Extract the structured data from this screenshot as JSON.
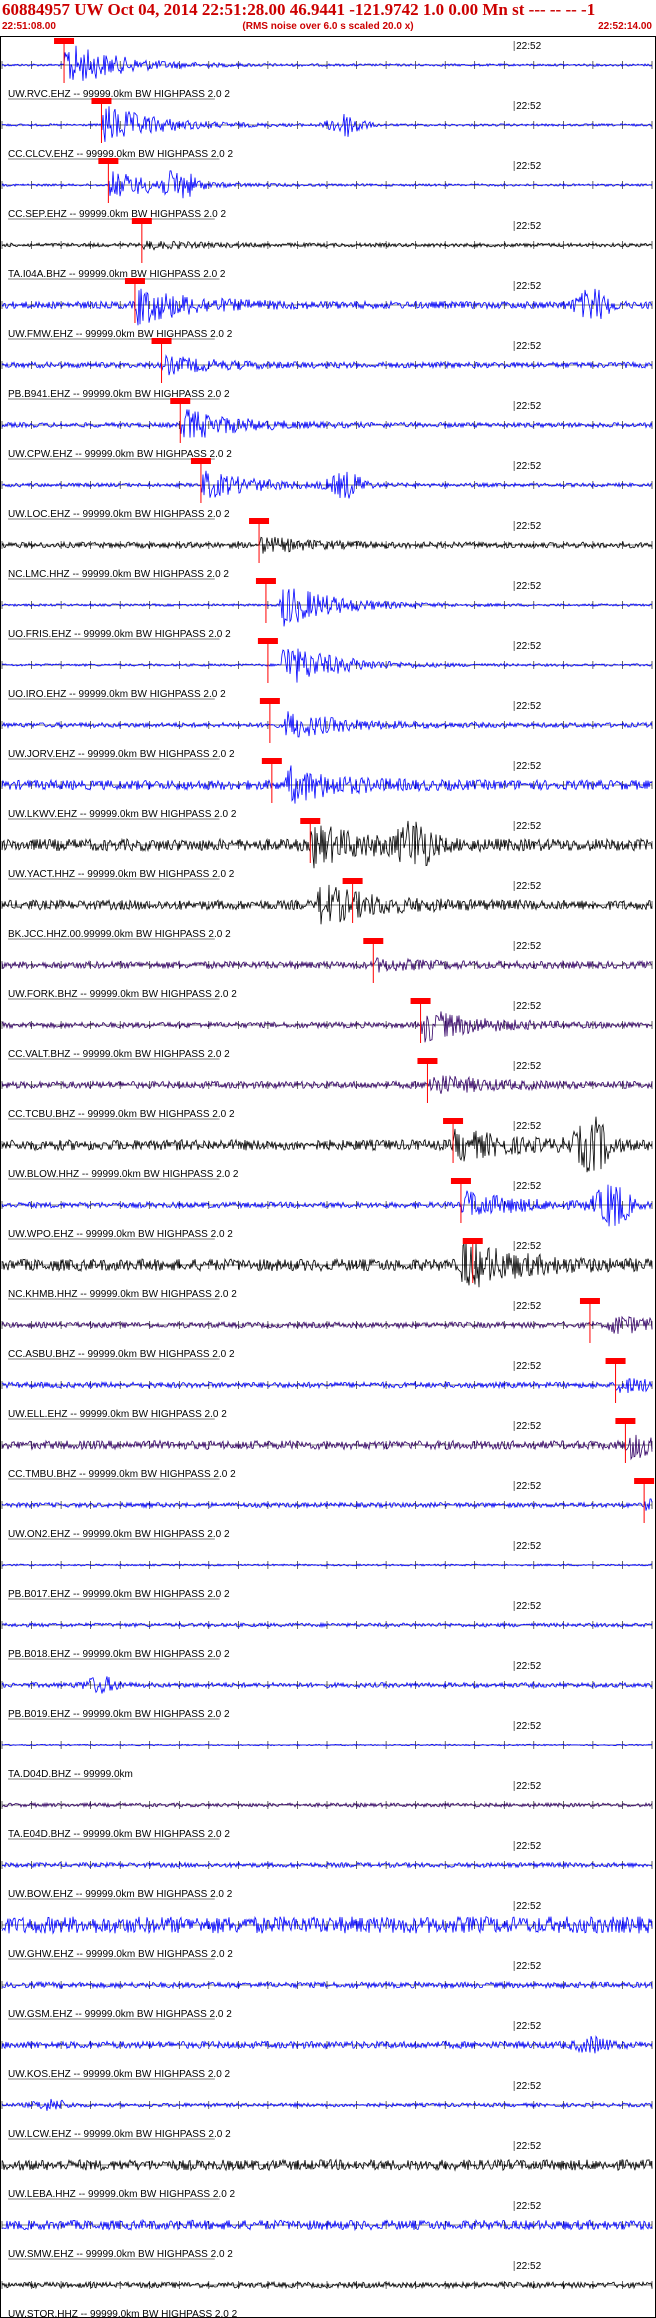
{
  "header": {
    "title": "60884957 UW Oct 04, 2014 22:51:28.00   46.9441 -121.9742  1.0 0.00 Mn st --- -- --  -1",
    "start_time": "22:51:08.00",
    "end_time": "22:52:14.00",
    "rms_note": "(RMS noise over 6.0 s scaled 20.0 x)"
  },
  "chart_data": {
    "type": "line",
    "x_range_seconds": [
      0,
      66
    ],
    "minor_tick_interval_s": 3,
    "time_label": "22:52",
    "time_label_offset_s": 52,
    "colors": {
      "blue": "#0000ff",
      "black": "#000000",
      "purple": "#330066",
      "pick": "#ff0000"
    },
    "series": [
      {
        "label": "UW.RVC.EHZ -- 99999.0km BW  HIGHPASS  2.0  2",
        "color": "blue",
        "pick": 6.3,
        "onset": 6.3,
        "amp": 1.0,
        "noise": 0.05,
        "secondary": null
      },
      {
        "label": "CC.CLCV.EHZ -- 99999.0km BW  HIGHPASS  2.0  2",
        "color": "blue",
        "pick": 10.1,
        "onset": 10.1,
        "amp": 0.9,
        "noise": 0.05,
        "secondary": [
          35,
          0.5
        ]
      },
      {
        "label": "CC.SEP.EHZ -- 99999.0km BW  HIGHPASS  2.0  2",
        "color": "blue",
        "pick": 10.8,
        "onset": 10.8,
        "amp": 0.6,
        "noise": 0.05,
        "secondary": [
          18,
          0.5
        ]
      },
      {
        "label": "TA.I04A.BHZ -- 99999.0km BW  HIGHPASS  2.0  2",
        "color": "black",
        "pick": 14.2,
        "onset": 14.2,
        "amp": 0.15,
        "noise": 0.08,
        "secondary": null
      },
      {
        "label": "UW.FMW.EHZ -- 99999.0km BW  HIGHPASS  2.0  2",
        "color": "blue",
        "pick": 13.5,
        "onset": 13.5,
        "amp": 0.8,
        "noise": 0.15,
        "secondary": [
          60,
          0.6
        ]
      },
      {
        "label": "PB.B941.EHZ -- 99999.0km BW  HIGHPASS  2.0  2",
        "color": "blue",
        "pick": 16.2,
        "onset": 16.2,
        "amp": 0.35,
        "noise": 0.12,
        "secondary": null
      },
      {
        "label": "UW.CPW.EHZ -- 99999.0km BW  HIGHPASS  2.0  2",
        "color": "blue",
        "pick": 18.1,
        "onset": 18.1,
        "amp": 0.7,
        "noise": 0.1,
        "secondary": null
      },
      {
        "label": "UW.LOC.EHZ -- 99999.0km BW  HIGHPASS  2.0  2",
        "color": "blue",
        "pick": 20.2,
        "onset": 20.2,
        "amp": 0.6,
        "noise": 0.08,
        "secondary": [
          35,
          0.5
        ]
      },
      {
        "label": "NC.LMC.HHZ -- 99999.0km BW  HIGHPASS  2.0  2",
        "color": "black",
        "pick": 26.1,
        "onset": 26.1,
        "amp": 0.3,
        "noise": 0.12,
        "secondary": null
      },
      {
        "label": "UO.FRIS.EHZ -- 99999.0km BW  HIGHPASS  2.0  2",
        "color": "blue",
        "pick": 26.8,
        "onset": 28.1,
        "amp": 1.0,
        "noise": 0.05,
        "secondary": null
      },
      {
        "label": "UO.IRO.EHZ -- 99999.0km BW  HIGHPASS  2.0  2",
        "color": "blue",
        "pick": 27.0,
        "onset": 28.3,
        "amp": 1.0,
        "noise": 0.05,
        "secondary": null
      },
      {
        "label": "UW.JORV.EHZ -- 99999.0km BW  HIGHPASS  2.0  2",
        "color": "blue",
        "pick": 27.2,
        "onset": 28.7,
        "amp": 0.6,
        "noise": 0.1,
        "secondary": null
      },
      {
        "label": "UW.LKWV.EHZ -- 99999.0km BW  HIGHPASS  2.0  2",
        "color": "blue",
        "pick": 27.4,
        "onset": 28.8,
        "amp": 0.7,
        "noise": 0.2,
        "secondary": null
      },
      {
        "label": "UW.YACT.HHZ -- 99999.0km BW  HIGHPASS  2.0  2",
        "color": "black",
        "pick": 31.3,
        "onset": 31.3,
        "amp": 0.8,
        "noise": 0.25,
        "secondary": [
          42,
          0.9
        ]
      },
      {
        "label": "BK.JCC.HHZ.00.99999.0km BW  HIGHPASS  2.0  2",
        "color": "black",
        "pick": 35.6,
        "onset": 32.0,
        "amp": 0.85,
        "noise": 0.2,
        "secondary": null
      },
      {
        "label": "UW.FORK.BHZ -- 99999.0km BW  HIGHPASS  2.0  2",
        "color": "purple",
        "pick": 37.7,
        "onset": 37.7,
        "amp": 0.2,
        "noise": 0.15,
        "secondary": null
      },
      {
        "label": "CC.VALT.BHZ -- 99999.0km BW  HIGHPASS  2.0  2",
        "color": "purple",
        "pick": 42.5,
        "onset": 42.5,
        "amp": 0.7,
        "noise": 0.12,
        "secondary": null
      },
      {
        "label": "CC.TCBU.BHZ -- 99999.0km BW  HIGHPASS  2.0  2",
        "color": "purple",
        "pick": 43.2,
        "onset": 43.2,
        "amp": 0.4,
        "noise": 0.15,
        "secondary": null
      },
      {
        "label": "UW.BLOW.HHZ -- 99999.0km BW  HIGHPASS  2.0  2",
        "color": "black",
        "pick": 45.8,
        "onset": 45.8,
        "amp": 0.6,
        "noise": 0.22,
        "secondary": [
          60,
          1.0
        ]
      },
      {
        "label": "UW.WPO.EHZ -- 99999.0km BW  HIGHPASS  2.0  2",
        "color": "blue",
        "pick": 46.6,
        "onset": 46.6,
        "amp": 0.6,
        "noise": 0.12,
        "secondary": [
          62,
          0.9
        ]
      },
      {
        "label": "NC.KHMB.HHZ -- 99999.0km BW  HIGHPASS  2.0  2",
        "color": "black",
        "pick": 47.8,
        "onset": 46.5,
        "amp": 1.0,
        "noise": 0.25,
        "secondary": null
      },
      {
        "label": "CC.ASBU.BHZ -- 99999.0km BW  HIGHPASS  2.0  2",
        "color": "purple",
        "pick": 59.7,
        "onset": 61.5,
        "amp": 0.4,
        "noise": 0.12,
        "secondary": null
      },
      {
        "label": "UW.ELL.EHZ -- 99999.0km BW  HIGHPASS  2.0  2",
        "color": "blue",
        "pick": 62.3,
        "onset": 62.3,
        "amp": 0.3,
        "noise": 0.12,
        "secondary": null
      },
      {
        "label": "CC.TMBU.BHZ -- 99999.0km BW  HIGHPASS  2.0  2",
        "color": "purple",
        "pick": 63.3,
        "onset": 63.3,
        "amp": 0.5,
        "noise": 0.18,
        "secondary": null
      },
      {
        "label": "UW.ON2.EHZ -- 99999.0km BW  HIGHPASS  2.0  2",
        "color": "blue",
        "pick": 65.2,
        "onset": 65.2,
        "amp": 0.2,
        "noise": 0.1,
        "secondary": null
      },
      {
        "label": "PB.B017.EHZ -- 99999.0km BW  HIGHPASS  2.0  2",
        "color": "blue",
        "pick": null,
        "onset": null,
        "amp": 0,
        "noise": 0.04,
        "secondary": null
      },
      {
        "label": "PB.B018.EHZ -- 99999.0km BW  HIGHPASS  2.0  2",
        "color": "blue",
        "pick": null,
        "onset": null,
        "amp": 0,
        "noise": 0.08,
        "secondary": null
      },
      {
        "label": "PB.B019.EHZ -- 99999.0km BW  HIGHPASS  2.0  2",
        "color": "blue",
        "pick": null,
        "onset": null,
        "amp": 0,
        "noise": 0.1,
        "secondary": [
          10,
          0.3
        ]
      },
      {
        "label": "TA.D04D.BHZ -- 99999.0km",
        "color": "blue",
        "pick": null,
        "onset": null,
        "amp": 0,
        "noise": 0.03,
        "secondary": null
      },
      {
        "label": "TA.E04D.BHZ -- 99999.0km BW  HIGHPASS  2.0  2",
        "color": "purple",
        "pick": null,
        "onset": null,
        "amp": 0,
        "noise": 0.08,
        "secondary": null
      },
      {
        "label": "UW.BOW.EHZ -- 99999.0km BW  HIGHPASS  2.0  2",
        "color": "blue",
        "pick": null,
        "onset": null,
        "amp": 0,
        "noise": 0.1,
        "secondary": null
      },
      {
        "label": "UW.GHW.EHZ -- 99999.0km BW  HIGHPASS  2.0  2",
        "color": "blue",
        "pick": null,
        "onset": null,
        "amp": 0,
        "noise": 0.35,
        "secondary": null
      },
      {
        "label": "UW.GSM.EHZ -- 99999.0km BW  HIGHPASS  2.0  2",
        "color": "blue",
        "pick": null,
        "onset": null,
        "amp": 0,
        "noise": 0.12,
        "secondary": null
      },
      {
        "label": "UW.KOS.EHZ -- 99999.0km BW  HIGHPASS  2.0  2",
        "color": "blue",
        "pick": null,
        "onset": null,
        "amp": 0,
        "noise": 0.15,
        "secondary": [
          60,
          0.25
        ]
      },
      {
        "label": "UW.LCW.EHZ -- 99999.0km BW  HIGHPASS  2.0  2",
        "color": "blue",
        "pick": null,
        "onset": null,
        "amp": 0,
        "noise": 0.08,
        "secondary": [
          5,
          0.2
        ]
      },
      {
        "label": "UW.LEBA.HHZ -- 99999.0km BW  HIGHPASS  2.0  2",
        "color": "black",
        "pick": null,
        "onset": null,
        "amp": 0,
        "noise": 0.22,
        "secondary": null
      },
      {
        "label": "UW.SMW.EHZ -- 99999.0km BW  HIGHPASS  2.0  2",
        "color": "blue",
        "pick": null,
        "onset": null,
        "amp": 0,
        "noise": 0.2,
        "secondary": null
      },
      {
        "label": "UW.STOR.HHZ -- 99999.0km BW  HIGHPASS  2.0  2",
        "color": "black",
        "pick": null,
        "onset": null,
        "amp": 0,
        "noise": 0.12,
        "secondary": null
      }
    ]
  }
}
